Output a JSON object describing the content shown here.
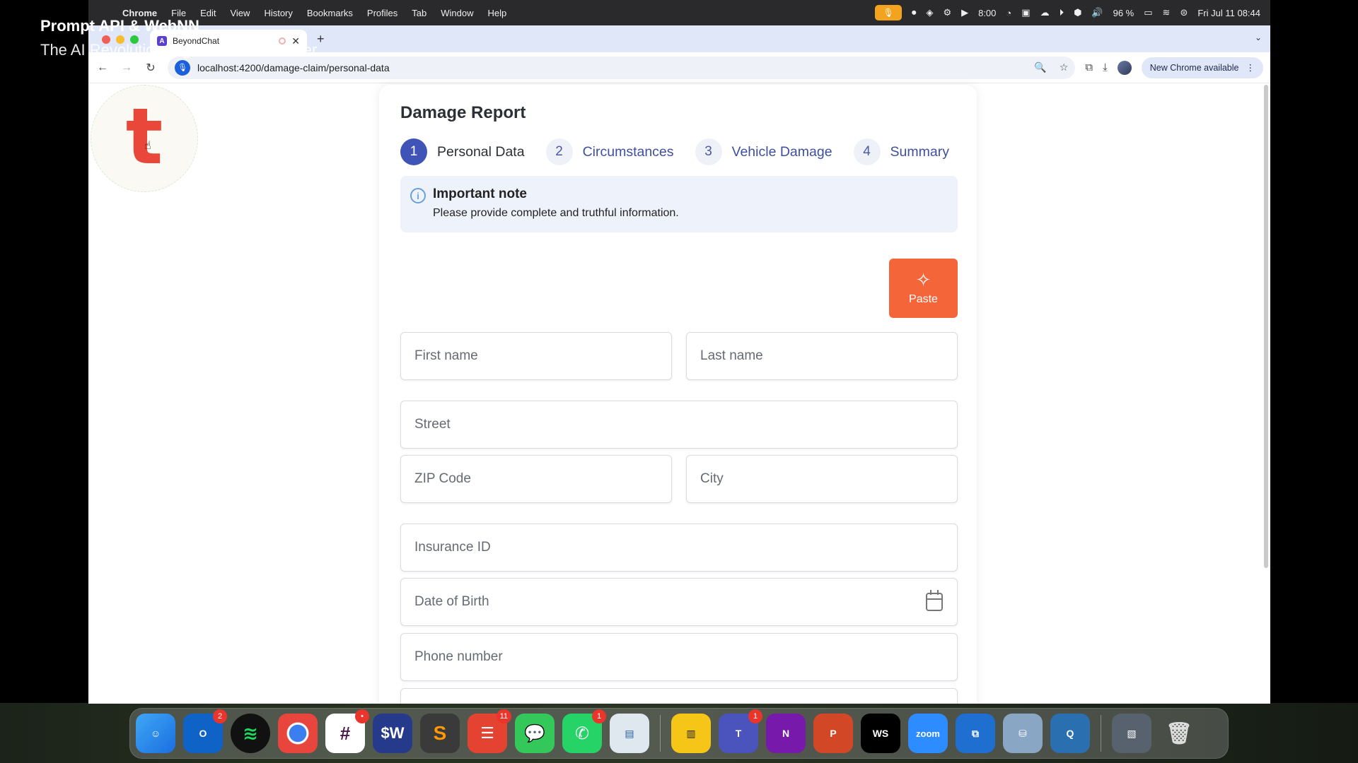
{
  "overlay": {
    "title": "Prompt API & WebNN",
    "subtitle": "The AI Revolution Right in Your Browser"
  },
  "menubar": {
    "app": "Chrome",
    "items": [
      "File",
      "Edit",
      "View",
      "History",
      "Bookmarks",
      "Profiles",
      "Tab",
      "Window",
      "Help"
    ],
    "timer": "8:00",
    "battery": "96 %",
    "datetime": "Fri Jul 11  08:44"
  },
  "browser": {
    "tab_title": "BeyondChat",
    "url": "localhost:4200/damage-claim/personal-data",
    "update_label": "New Chrome available"
  },
  "page": {
    "logo_letter": "t",
    "title": "Damage Report",
    "steps": [
      {
        "num": "1",
        "label": "Personal Data",
        "active": true
      },
      {
        "num": "2",
        "label": "Circumstances",
        "active": false
      },
      {
        "num": "3",
        "label": "Vehicle Damage",
        "active": false
      },
      {
        "num": "4",
        "label": "Summary",
        "active": false
      }
    ],
    "note": {
      "title": "Important note",
      "text": "Please provide complete and truthful information."
    },
    "paste_label": "Paste",
    "fields": {
      "first_name": "First name",
      "last_name": "Last name",
      "street": "Street",
      "zip": "ZIP Code",
      "city": "City",
      "insurance_id": "Insurance ID",
      "dob": "Date of Birth",
      "phone": "Phone number"
    }
  },
  "dock": {
    "badges": {
      "outlook": "2",
      "slack": "•",
      "todoist": "11",
      "whatsapp": "1",
      "teams": "1"
    }
  },
  "colors": {
    "accent": "#4054b8",
    "paste": "#f4663a",
    "logo": "#e8473a"
  }
}
